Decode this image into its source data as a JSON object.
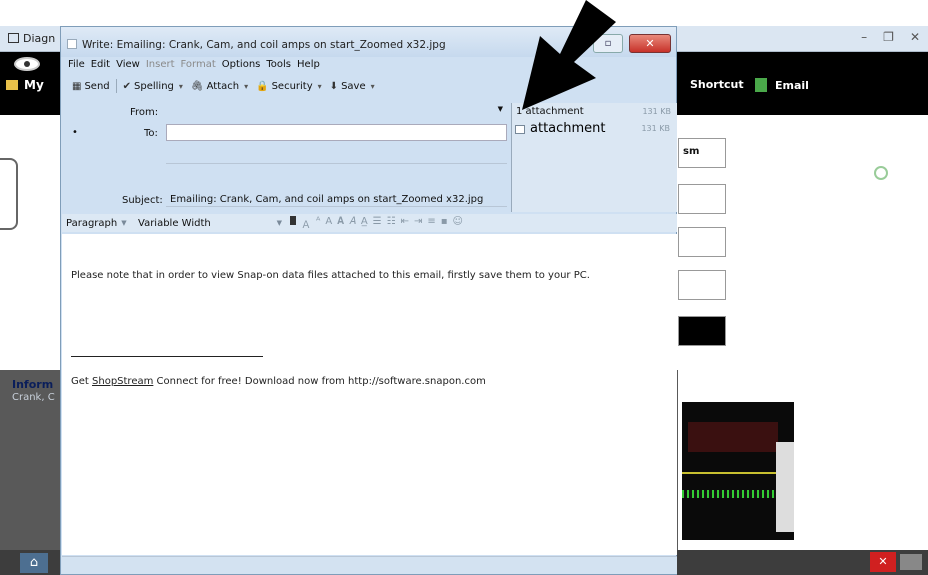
{
  "background_app": {
    "title": "Diagn",
    "toolbar_my": "My",
    "shortcut": "Shortcut",
    "email": "Email",
    "right_button_1": "sm",
    "info_title": "Inform",
    "info_sub": "Crank, C"
  },
  "window": {
    "title": "Write: Emailing: Crank, Cam, and coil amps on start_Zoomed x32.jpg"
  },
  "menus": [
    "File",
    "Edit",
    "View",
    "Insert",
    "Format",
    "Options",
    "Tools",
    "Help"
  ],
  "toolbar": {
    "send": "Send",
    "spelling": "Spelling",
    "attach": "Attach",
    "security": "Security",
    "save": "Save"
  },
  "header": {
    "from_label": "From:",
    "from_value": "",
    "to_label": "To:",
    "to_value": "",
    "subject_label": "Subject:",
    "subject_value": "Emailing: Crank, Cam, and coil amps on start_Zoomed x32.jpg"
  },
  "attachments": {
    "header": "1 attachment",
    "header_size": "131 KB",
    "items": [
      {
        "name": "attachment",
        "size": "131 KB"
      }
    ]
  },
  "format_bar": {
    "paragraph": "Paragraph",
    "font": "Variable Width"
  },
  "body": {
    "note": "Please note that in order to view Snap-on data files attached to this email, firstly save them to your PC.",
    "promo_prefix": "Get ",
    "promo_link": "ShopStream",
    "promo_suffix": " Connect for free! Download now from http://software.snapon.com"
  },
  "colors": {
    "window_frame": "#cfe0f2",
    "close_button": "#c7322a",
    "app_toolbar": "#000000"
  }
}
